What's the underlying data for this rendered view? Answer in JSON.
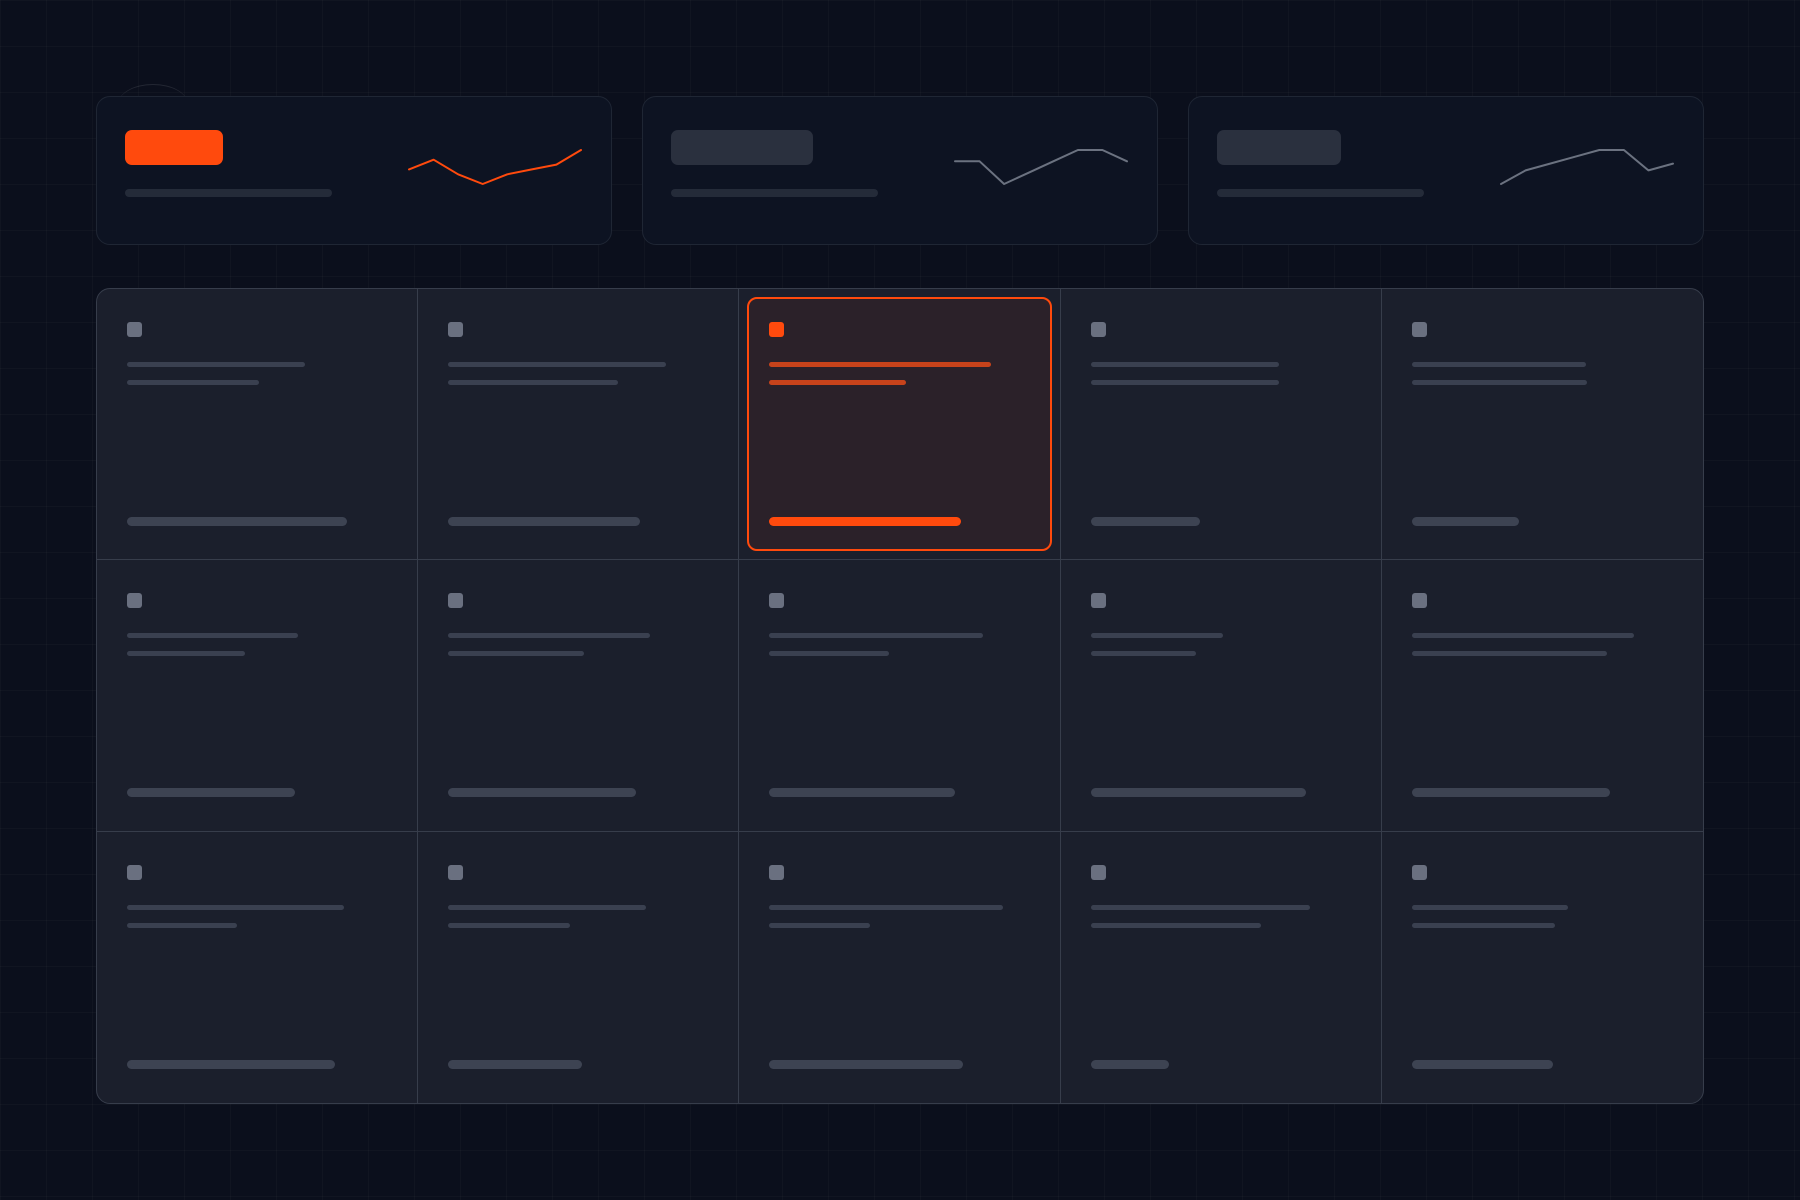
{
  "colors": {
    "background": "#0b0f1c",
    "accent": "#ff4a0d",
    "card": "#0d1322",
    "grid_panel": "#1b1f2c",
    "muted_line": "#6b7280"
  },
  "stats": [
    {
      "selected": true,
      "sparkline": [
        4,
        6,
        3,
        1,
        3,
        4,
        5,
        8
      ]
    },
    {
      "selected": false,
      "sparkline": [
        5,
        5,
        1,
        3,
        5,
        7,
        7,
        5
      ]
    },
    {
      "selected": false,
      "sparkline": [
        0,
        2,
        3,
        4,
        5,
        5,
        2,
        3
      ]
    }
  ],
  "grid": {
    "rows": 3,
    "columns": 5,
    "selected_cell": {
      "row": 1,
      "column": 3
    }
  }
}
